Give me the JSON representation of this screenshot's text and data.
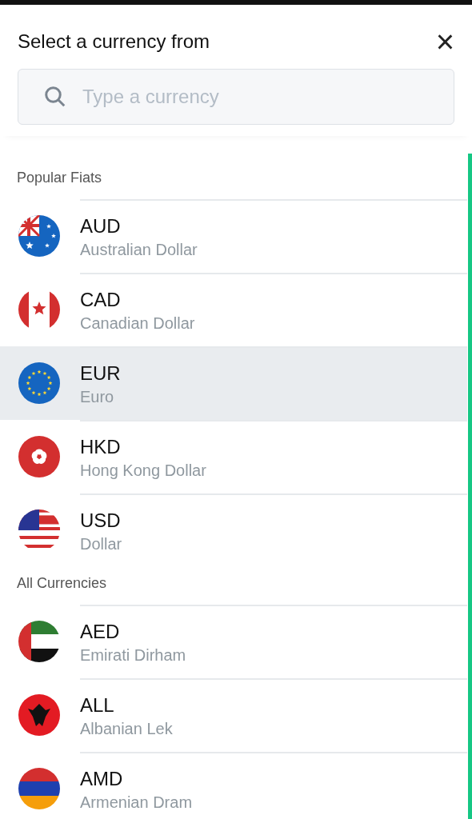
{
  "header": {
    "title": "Select a currency from",
    "close": "×"
  },
  "search": {
    "placeholder": "Type a currency"
  },
  "sections": [
    {
      "title": "Popular Fiats",
      "items": [
        {
          "code": "AUD",
          "name": "Australian Dollar",
          "selected": false
        },
        {
          "code": "CAD",
          "name": "Canadian Dollar",
          "selected": false
        },
        {
          "code": "EUR",
          "name": "Euro",
          "selected": true
        },
        {
          "code": "HKD",
          "name": "Hong Kong Dollar",
          "selected": false
        },
        {
          "code": "USD",
          "name": "Dollar",
          "selected": false
        }
      ]
    },
    {
      "title": "All Currencies",
      "items": [
        {
          "code": "AED",
          "name": "Emirati Dirham",
          "selected": false
        },
        {
          "code": "ALL",
          "name": "Albanian Lek",
          "selected": false
        },
        {
          "code": "AMD",
          "name": "Armenian Dram",
          "selected": false
        }
      ]
    }
  ]
}
